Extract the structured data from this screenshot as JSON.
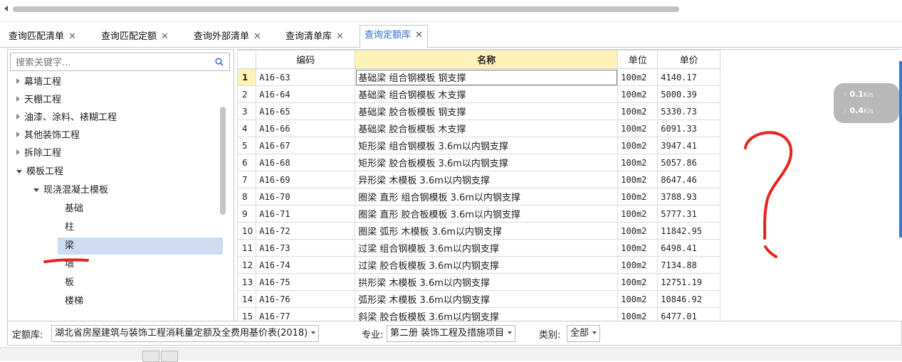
{
  "tabs": [
    {
      "label": "查询匹配清单",
      "close": "✕"
    },
    {
      "label": "查询匹配定额",
      "close": "✕"
    },
    {
      "label": "查询外部清单",
      "close": "✕"
    },
    {
      "label": "查询清单库",
      "close": "✕"
    },
    {
      "label": "查询定额库",
      "close": "✕",
      "active": true
    }
  ],
  "search": {
    "placeholder": "搜索关键字..."
  },
  "tree": [
    {
      "label": "幕墙工程",
      "expanded": false,
      "level": 0
    },
    {
      "label": "天棚工程",
      "expanded": false,
      "level": 0
    },
    {
      "label": "油漆、涂料、裱糊工程",
      "expanded": false,
      "level": 0
    },
    {
      "label": "其他装饰工程",
      "expanded": false,
      "level": 0
    },
    {
      "label": "拆除工程",
      "expanded": false,
      "level": 0
    },
    {
      "label": "模板工程",
      "expanded": true,
      "level": 0
    },
    {
      "label": "现浇混凝土模板",
      "expanded": true,
      "level": 1
    },
    {
      "label": "基础",
      "level": 2
    },
    {
      "label": "柱",
      "level": 2
    },
    {
      "label": "梁",
      "level": 2,
      "selected": true
    },
    {
      "label": "墙",
      "level": 2
    },
    {
      "label": "板",
      "level": 2
    },
    {
      "label": "楼梯",
      "level": 2
    }
  ],
  "table": {
    "headers": {
      "code": "编码",
      "name": "名称",
      "unit": "单位",
      "price": "单价"
    },
    "rows": [
      {
        "n": "1",
        "code": "A16-63",
        "name": "基础梁 组合钢模板 钢支撑",
        "unit": "100m2",
        "price": "4140.17"
      },
      {
        "n": "2",
        "code": "A16-64",
        "name": "基础梁 组合钢模板 木支撑",
        "unit": "100m2",
        "price": "5000.39"
      },
      {
        "n": "3",
        "code": "A16-65",
        "name": "基础梁 胶合板模板 钢支撑",
        "unit": "100m2",
        "price": "5330.73"
      },
      {
        "n": "4",
        "code": "A16-66",
        "name": "基础梁 胶合板模板 木支撑",
        "unit": "100m2",
        "price": "6091.33"
      },
      {
        "n": "5",
        "code": "A16-67",
        "name": "矩形梁 组合钢模板 3.6m以内钢支撑",
        "unit": "100m2",
        "price": "3947.41"
      },
      {
        "n": "6",
        "code": "A16-68",
        "name": "矩形梁 胶合板模板 3.6m以内钢支撑",
        "unit": "100m2",
        "price": "5057.86"
      },
      {
        "n": "7",
        "code": "A16-69",
        "name": "异形梁 木模板 3.6m以内钢支撑",
        "unit": "100m2",
        "price": "8647.46"
      },
      {
        "n": "8",
        "code": "A16-70",
        "name": "圈梁 直形 组合钢模板 3.6m以内钢支撑",
        "unit": "100m2",
        "price": "3788.93"
      },
      {
        "n": "9",
        "code": "A16-71",
        "name": "圈梁 直形 胶合板模板 3.6m以内钢支撑",
        "unit": "100m2",
        "price": "5777.31"
      },
      {
        "n": "10",
        "code": "A16-72",
        "name": "圈梁 弧形 木模板 3.6m以内钢支撑",
        "unit": "100m2",
        "price": "11842.95"
      },
      {
        "n": "11",
        "code": "A16-73",
        "name": "过梁 组合钢模板 3.6m以内钢支撑",
        "unit": "100m2",
        "price": "6498.41"
      },
      {
        "n": "12",
        "code": "A16-74",
        "name": "过梁 胶合板模板 3.6m以内钢支撑",
        "unit": "100m2",
        "price": "7134.88"
      },
      {
        "n": "13",
        "code": "A16-75",
        "name": "拱形梁 木模板 3.6m以内钢支撑",
        "unit": "100m2",
        "price": "12751.19"
      },
      {
        "n": "14",
        "code": "A16-76",
        "name": "弧形梁 木模板 3.6m以内钢支撑",
        "unit": "100m2",
        "price": "10846.92"
      },
      {
        "n": "15",
        "code": "A16-77",
        "name": "斜梁 胶合板模板 3.6m以内钢支撑",
        "unit": "100m2",
        "price": "6477.01"
      }
    ]
  },
  "filter": {
    "library_label": "定额库:",
    "library_value": "湖北省房屋建筑与装饰工程消耗量定额及全费用基价表(2018)",
    "major_label": "专业:",
    "major_value": "第二册 装饰工程及措施项目",
    "category_label": "类别:",
    "category_value": "全部"
  },
  "speed": {
    "up": "0.1",
    "down": "0.4",
    "unit": "K/s"
  },
  "annotation": {
    "mark": "?",
    "color": "#e8231f"
  }
}
